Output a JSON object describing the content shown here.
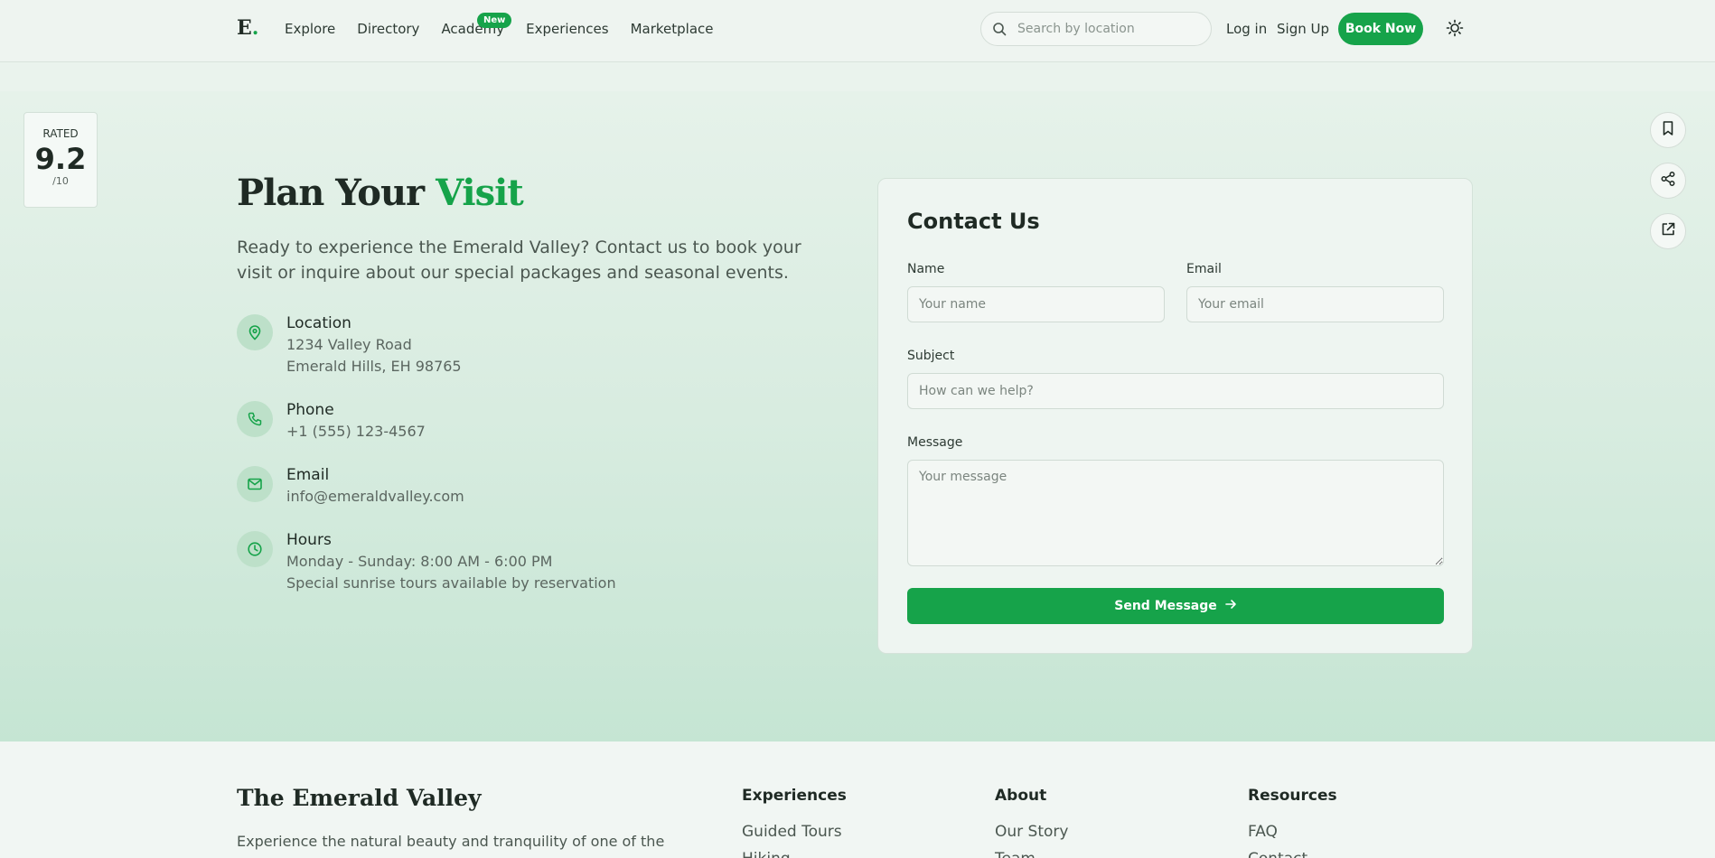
{
  "header": {
    "logo_letter": "E",
    "logo_dot": ".",
    "nav": [
      "Explore",
      "Directory",
      "Academy",
      "Experiences",
      "Marketplace"
    ],
    "new_badge": "New",
    "search_placeholder": "Search by location",
    "login": "Log in",
    "signup": "Sign Up",
    "book_now": "Book Now"
  },
  "rating": {
    "label": "RATED",
    "score": "9.2",
    "out_of": "/10"
  },
  "plan": {
    "title": "Plan Your",
    "title_accent": "Visit",
    "description": "Ready to experience the Emerald Valley? Contact us to book your visit or inquire about our special packages and seasonal events.",
    "location": {
      "title": "Location",
      "line1": "1234 Valley Road",
      "line2": "Emerald Hills, EH 98765"
    },
    "phone": {
      "title": "Phone",
      "line1": "+1 (555) 123-4567"
    },
    "email": {
      "title": "Email",
      "line1": "info@emeraldvalley.com"
    },
    "hours": {
      "title": "Hours",
      "line1": "Monday - Sunday: 8:00 AM - 6:00 PM",
      "line2": "Special sunrise tours available by reservation"
    }
  },
  "contact": {
    "title": "Contact Us",
    "name_label": "Name",
    "name_placeholder": "Your name",
    "email_label": "Email",
    "email_placeholder": "Your email",
    "subject_label": "Subject",
    "subject_placeholder": "How can we help?",
    "message_label": "Message",
    "message_placeholder": "Your message",
    "send_label": "Send Message"
  },
  "footer": {
    "brand": "The Emerald Valley",
    "description": "Experience the natural beauty and tranquility of one of the world's",
    "experiences_title": "Experiences",
    "experiences_links": [
      "Guided Tours",
      "Hiking"
    ],
    "about_title": "About",
    "about_links": [
      "Our Story",
      "Team"
    ],
    "resources_title": "Resources",
    "resources_links": [
      "FAQ",
      "Contact"
    ]
  },
  "colors": {
    "accent": "#16a34a",
    "icon_bg": "#bde0c9"
  }
}
